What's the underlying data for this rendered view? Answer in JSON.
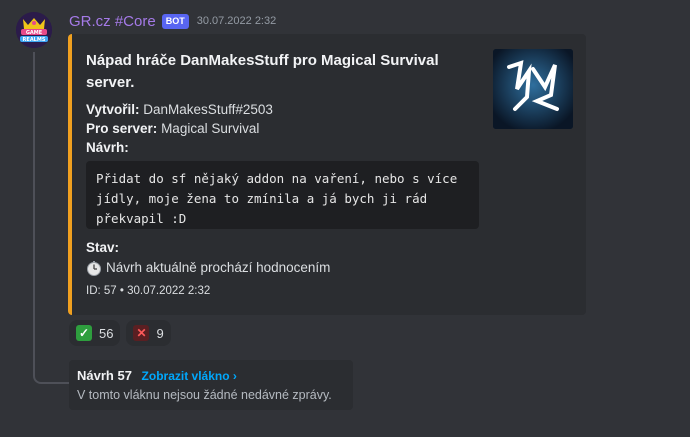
{
  "message": {
    "author": "GR.cz #Core",
    "badge": "BOT",
    "timestamp": "30.07.2022 2:32",
    "avatar_label": "GAME REALMS"
  },
  "embed": {
    "accent": "#f0a020",
    "title": "Nápad hráče DanMakesStuff pro Magical Survival server.",
    "created_by_label": "Vytvořil:",
    "created_by": "DanMakesStuff#2503",
    "server_label": "Pro server:",
    "server": "Magical Survival",
    "proposal_label": "Návrh:",
    "proposal_text": "Přidat do sf nějaký addon na vaření, nebo s více jídly, moje žena to zmínila a já bych ji rád překvapil :D",
    "status_label": "Stav:",
    "status_icon": "stopwatch-icon",
    "status_text": "Návrh aktuálně prochází hodnocením",
    "footer": "ID: 57 • 30.07.2022 2:32"
  },
  "reactions": [
    {
      "icon": "check-mark-icon",
      "count": "56",
      "color": "#2e9e3e"
    },
    {
      "icon": "cross-mark-icon",
      "count": "9",
      "color": "#5a1f22"
    }
  ],
  "thread": {
    "title": "Návrh 57",
    "link": "Zobrazit vlákno ›",
    "subtitle": "V tomto vláknu nejsou žádné nedávné zprávy."
  }
}
